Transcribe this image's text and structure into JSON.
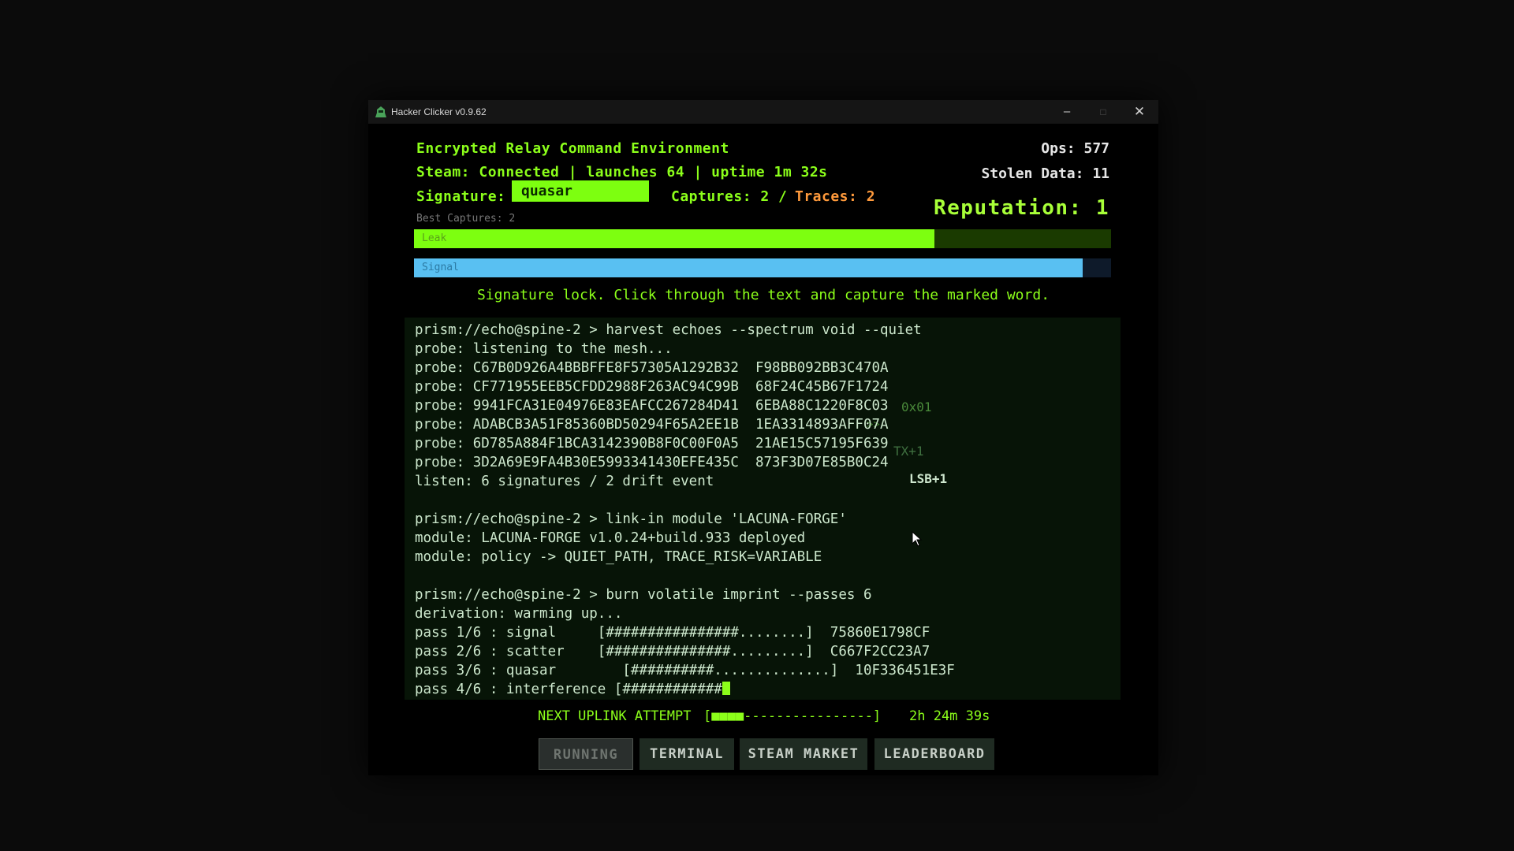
{
  "window": {
    "title": "Hacker Clicker v0.9.62",
    "controls": {
      "minimize": "–",
      "maximize": "□",
      "close": "✕"
    }
  },
  "header": {
    "env_title": "Encrypted Relay Command Environment",
    "status_line": "Steam: Connected | launches 64 | uptime 1m 32s",
    "signature_label": "Signature:",
    "signature_value": "quasar",
    "captures": "Captures: 2 /",
    "traces": "Traces: 2",
    "best_captures": "Best Captures: 2",
    "ops": "Ops: 577",
    "stolen": "Stolen Data: 11",
    "reputation": "Reputation: 1"
  },
  "bars": {
    "leak": {
      "label": "Leak",
      "fraction": 0.747,
      "color": "#7dff10"
    },
    "signal": {
      "label": "Signal",
      "fraction": 0.959,
      "color": "#59c0f2"
    }
  },
  "instruction": "Signature lock. Click through the text and capture the marked word.",
  "terminal": {
    "lines": [
      "prism://echo@spine-2 > harvest echoes --spectrum void --quiet",
      "probe: listening to the mesh...",
      "probe: C67B0D926A4BBBFFE8F57305A1292B32  F98BB092BB3C470A",
      "probe: CF771955EEB5CFDD2988F263AC94C99B  68F24C45B67F1724",
      "probe: 9941FCA31E04976E83EAFCC267284D41  6EBA88C1220F8C03",
      "probe: ADABCB3A51F85360BD50294F65A2EE1B  1EA3314893AFF07A",
      "probe: 6D785A884F1BCA3142390B8F0C00F0A5  21AE15C57195F639",
      "probe: 3D2A69E9FA4B30E5993341430EFE435C  873F3D07E85B0C24",
      "listen: 6 signatures / 2 drift event",
      "",
      "prism://echo@spine-2 > link-in module 'LACUNA-FORGE'",
      "module: LACUNA-FORGE v1.0.24+build.933 deployed",
      "module: policy -> QUIET_PATH, TRACE_RISK=VARIABLE",
      "",
      "prism://echo@spine-2 > burn volatile imprint --passes 6",
      "derivation: warming up...",
      "pass 1/6 : signal     [################........]  75860E1798CF",
      "pass 2/6 : scatter    [###############.........]  C667F2CC23A7",
      "pass 3/6 : quasar        [##########..............]  10F336451E3F",
      "pass 4/6 : interference [############"
    ],
    "floaters": {
      "hex": "0x01",
      "chevrons": ">>",
      "tx": "TX+1",
      "lsb": "LSB+1"
    }
  },
  "uplink": {
    "label": "NEXT UPLINK ATTEMPT",
    "progress": "[■■■■----------------]",
    "fraction": 0.2,
    "time": "2h 24m 39s"
  },
  "tabs": [
    {
      "label": "RUNNING",
      "active": true
    },
    {
      "label": "TERMINAL",
      "active": false
    },
    {
      "label": "STEAM MARKET",
      "active": false
    },
    {
      "label": "LEADERBOARD",
      "active": false
    }
  ]
}
